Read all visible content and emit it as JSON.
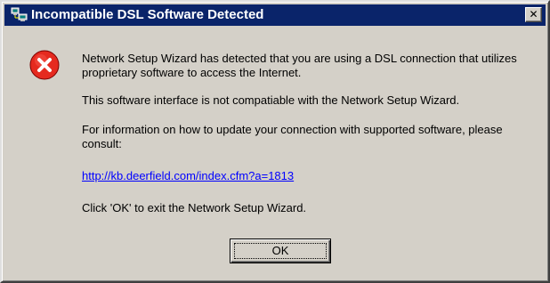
{
  "window": {
    "title": "Incompatible DSL Software Detected",
    "title_icon": "network-computers-icon",
    "close_label": "✕",
    "close_icon": "close-icon",
    "titlebar_color": "#0a246a",
    "face_color": "#d4d0c8"
  },
  "content": {
    "error_icon": "error-x-icon",
    "error_icon_color": "#e52a1f",
    "message_1": "Network Setup Wizard has detected that you are using a DSL connection that utilizes proprietary software to access the Internet.",
    "message_2": "This software interface is not compatiable with the Network Setup Wizard.",
    "message_3": "For information on how to update your connection with supported software, please consult:",
    "link_text": "http://kb.deerfield.com/index.cfm?a=1813",
    "link_color": "#0000ff",
    "message_4": "Click 'OK' to exit the Network Setup Wizard."
  },
  "buttons": {
    "ok_label": "OK"
  }
}
